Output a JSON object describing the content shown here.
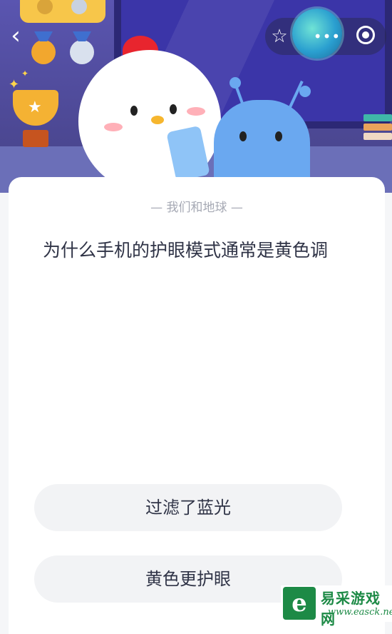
{
  "nav": {
    "back_icon": "chevron-left-icon",
    "star_icon": "star-outline-icon",
    "more_icon": "more-dots-icon",
    "close_icon": "target-circle-icon",
    "star_glyph": "☆",
    "more_glyph": "•••",
    "back_glyph": "‹"
  },
  "quiz": {
    "category": "— 我们和地球 —",
    "question": "为什么手机的护眼模式通常是黄色调",
    "options": [
      {
        "label": "过滤了蓝光"
      },
      {
        "label": "黄色更护眼"
      }
    ]
  },
  "watermark": {
    "title": "易采游戏网",
    "url": "www.easck.net",
    "logo_glyph": "e"
  },
  "colors": {
    "header_bg": "#4e4a9c",
    "card_bg": "#ffffff",
    "option_bg": "#f2f3f5",
    "text_primary": "#2f3346",
    "text_muted": "#a6a9b4",
    "watermark_green": "#1d8a46"
  }
}
